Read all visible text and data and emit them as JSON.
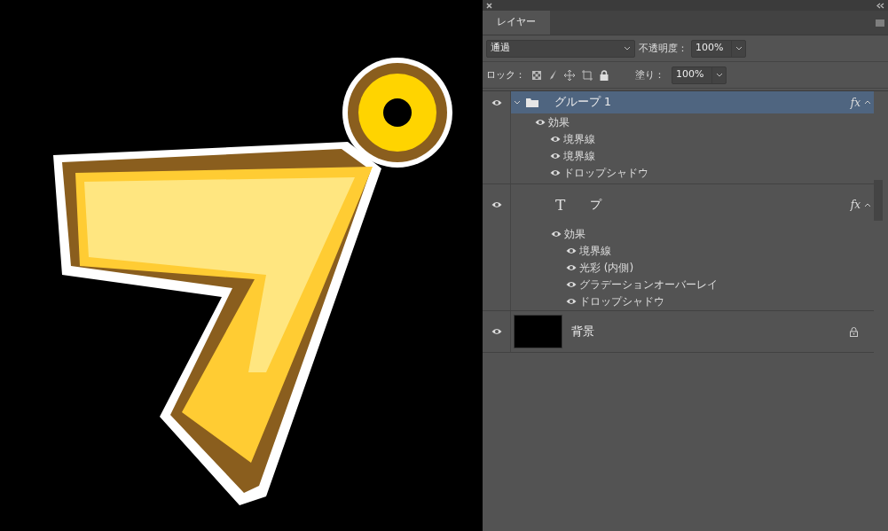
{
  "panel": {
    "tab": "レイヤー",
    "blend_mode": "通過",
    "opacity_label": "不透明度：",
    "opacity": "100%",
    "lock_label": "ロック：",
    "fill_label": "塗り：",
    "fill": "100%"
  },
  "layers": [
    {
      "kind": "group",
      "name": "グループ 1",
      "visible": true,
      "selected": true,
      "expanded": true,
      "fx": "fx",
      "effects_label": "効果",
      "effects": [
        {
          "name": "境界線",
          "visible": true
        },
        {
          "name": "境界線",
          "visible": true
        },
        {
          "name": "ドロップシャドウ",
          "visible": true
        }
      ]
    },
    {
      "kind": "text",
      "glyph": "T",
      "name": "プ",
      "visible": true,
      "selected": false,
      "expanded": true,
      "fx": "fx",
      "effects_label": "効果",
      "effects": [
        {
          "name": "境界線",
          "visible": true
        },
        {
          "name": "光彩 (内側)",
          "visible": true
        },
        {
          "name": "グラデーションオーバーレイ",
          "visible": true
        },
        {
          "name": "ドロップシャドウ",
          "visible": true
        }
      ]
    },
    {
      "name": "背景",
      "visible": true,
      "selected": false,
      "locked": true
    }
  ]
}
